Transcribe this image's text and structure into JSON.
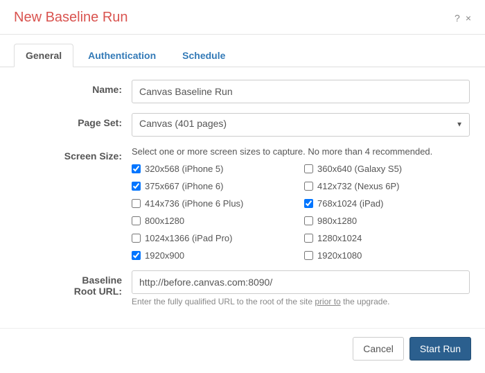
{
  "header": {
    "title": "New Baseline Run",
    "help_symbol": "?",
    "close_symbol": "×"
  },
  "tabs": [
    {
      "label": "General",
      "active": true
    },
    {
      "label": "Authentication",
      "active": false
    },
    {
      "label": "Schedule",
      "active": false
    }
  ],
  "form": {
    "name_label": "Name:",
    "name_value": "Canvas Baseline Run",
    "pageset_label": "Page Set:",
    "pageset_value": "Canvas (401 pages)",
    "screensize_label": "Screen Size:",
    "screensize_hint": "Select one or more screen sizes to capture. No more than 4 recommended.",
    "screen_sizes": [
      {
        "label": "320x568 (iPhone 5)",
        "checked": true
      },
      {
        "label": "360x640 (Galaxy S5)",
        "checked": false
      },
      {
        "label": "375x667 (iPhone 6)",
        "checked": true
      },
      {
        "label": "412x732 (Nexus 6P)",
        "checked": false
      },
      {
        "label": "414x736 (iPhone 6 Plus)",
        "checked": false
      },
      {
        "label": "768x1024 (iPad)",
        "checked": true
      },
      {
        "label": "800x1280",
        "checked": false
      },
      {
        "label": "980x1280",
        "checked": false
      },
      {
        "label": "1024x1366 (iPad Pro)",
        "checked": false
      },
      {
        "label": "1280x1024",
        "checked": false
      },
      {
        "label": "1920x900",
        "checked": true
      },
      {
        "label": "1920x1080",
        "checked": false
      }
    ],
    "baseline_label_line1": "Baseline",
    "baseline_label_line2": "Root URL:",
    "baseline_value": "http://before.canvas.com:8090/",
    "baseline_help_pre": "Enter the fully qualified URL to the root of the site ",
    "baseline_help_underline": "prior to",
    "baseline_help_post": " the upgrade."
  },
  "footer": {
    "cancel": "Cancel",
    "start": "Start Run"
  }
}
